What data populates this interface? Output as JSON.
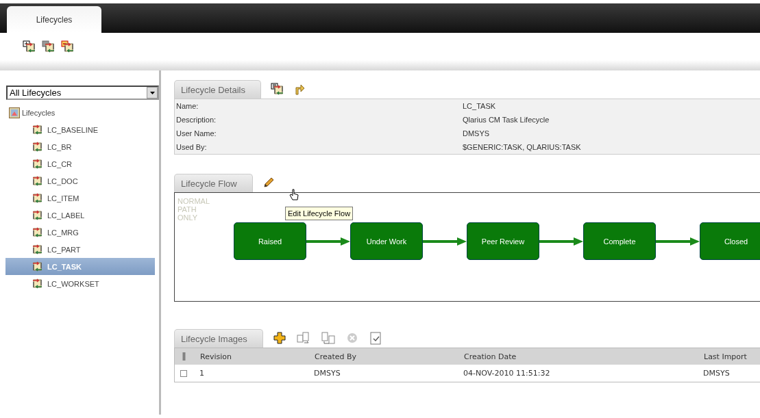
{
  "app_tabs": [
    {
      "label": "Lifecycles",
      "selected": true
    }
  ],
  "filter": {
    "value": "All Lifecycles"
  },
  "tree": {
    "label": "Lifecycles",
    "expanded": true,
    "children": [
      {
        "label": "LC_BASELINE",
        "selected": false
      },
      {
        "label": "LC_BR",
        "selected": false
      },
      {
        "label": "LC_CR",
        "selected": false
      },
      {
        "label": "LC_DOC",
        "selected": false
      },
      {
        "label": "LC_ITEM",
        "selected": false
      },
      {
        "label": "LC_LABEL",
        "selected": false
      },
      {
        "label": "LC_MRG",
        "selected": false
      },
      {
        "label": "LC_PART",
        "selected": false
      },
      {
        "label": "LC_TASK",
        "selected": true
      },
      {
        "label": "LC_WORKSET",
        "selected": false
      }
    ]
  },
  "details": {
    "tab": "Lifecycle Details",
    "fields": [
      {
        "label": "Name:",
        "value": "LC_TASK"
      },
      {
        "label": "Description:",
        "value": "Qlarius CM Task Lifecycle"
      },
      {
        "label": "User Name:",
        "value": "DMSYS"
      },
      {
        "label": "Used By:",
        "value": "$GENERIC:TASK,  QLARIUS:TASK"
      }
    ]
  },
  "flow": {
    "tab": "Lifecycle Flow",
    "legend": "NORMAL PATH ONLY",
    "tooltip": "Edit Lifecycle Flow",
    "states": [
      "Raised",
      "Under Work",
      "Peer Review",
      "Complete",
      "Closed"
    ]
  },
  "images": {
    "tab": "Lifecycle Images",
    "columns": [
      "Revision",
      "Created By",
      "Creation Date",
      "Last Import"
    ],
    "rows": [
      {
        "checked": false,
        "cells": [
          "1",
          "DMSYS",
          "04-NOV-2010 11:51:32",
          "DMSYS"
        ]
      }
    ]
  }
}
